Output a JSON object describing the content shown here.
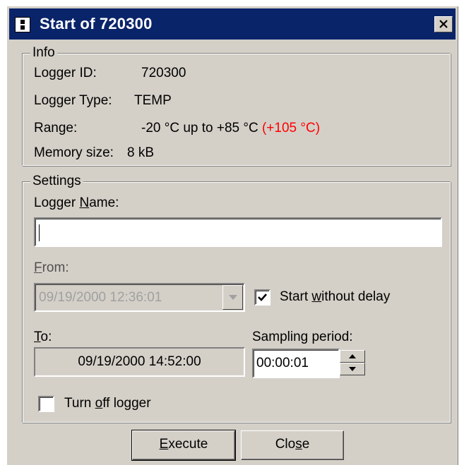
{
  "window": {
    "title": "Start of 720300",
    "title_icon": "device-icon",
    "close_icon": "close-x-icon"
  },
  "info": {
    "legend": "Info",
    "logger_id_label": "Logger ID:",
    "logger_id_value": "720300",
    "logger_type_label": "Logger Type:",
    "logger_type_value": "TEMP",
    "range_label": "Range:",
    "range_value": "-20 °C up to +85 °C",
    "range_extended": "(+105 °C)",
    "range_extended_color": "#ff0000",
    "memory_label": "Memory size:",
    "memory_value": "8 kB"
  },
  "settings": {
    "legend": "Settings",
    "logger_name_label_pre": "Logger ",
    "logger_name_label_key": "N",
    "logger_name_label_post": "ame:",
    "logger_name_value": "",
    "from_label_key": "F",
    "from_label_post": "rom:",
    "from_value": "09/19/2000 12:36:01",
    "from_enabled": false,
    "start_without_delay_pre": "Start ",
    "start_without_delay_key": "w",
    "start_without_delay_post": "ithout delay",
    "start_without_delay_checked": true,
    "to_label_key": "T",
    "to_label_post": "o:",
    "to_value": "09/19/2000 14:52:00",
    "sampling_period_label": "Sampling period:",
    "sampling_period_value": "00:00:01",
    "turn_off_pre": "Turn ",
    "turn_off_key": "o",
    "turn_off_post": "ff logger",
    "turn_off_checked": false
  },
  "buttons": {
    "execute_key": "E",
    "execute_post": "xecute",
    "close_pre": "Clo",
    "close_key": "s",
    "close_post": "e"
  },
  "colors": {
    "titlebar": "#0a246a",
    "dialog_face": "#d4d0c8",
    "accent_red": "#ff0000"
  }
}
